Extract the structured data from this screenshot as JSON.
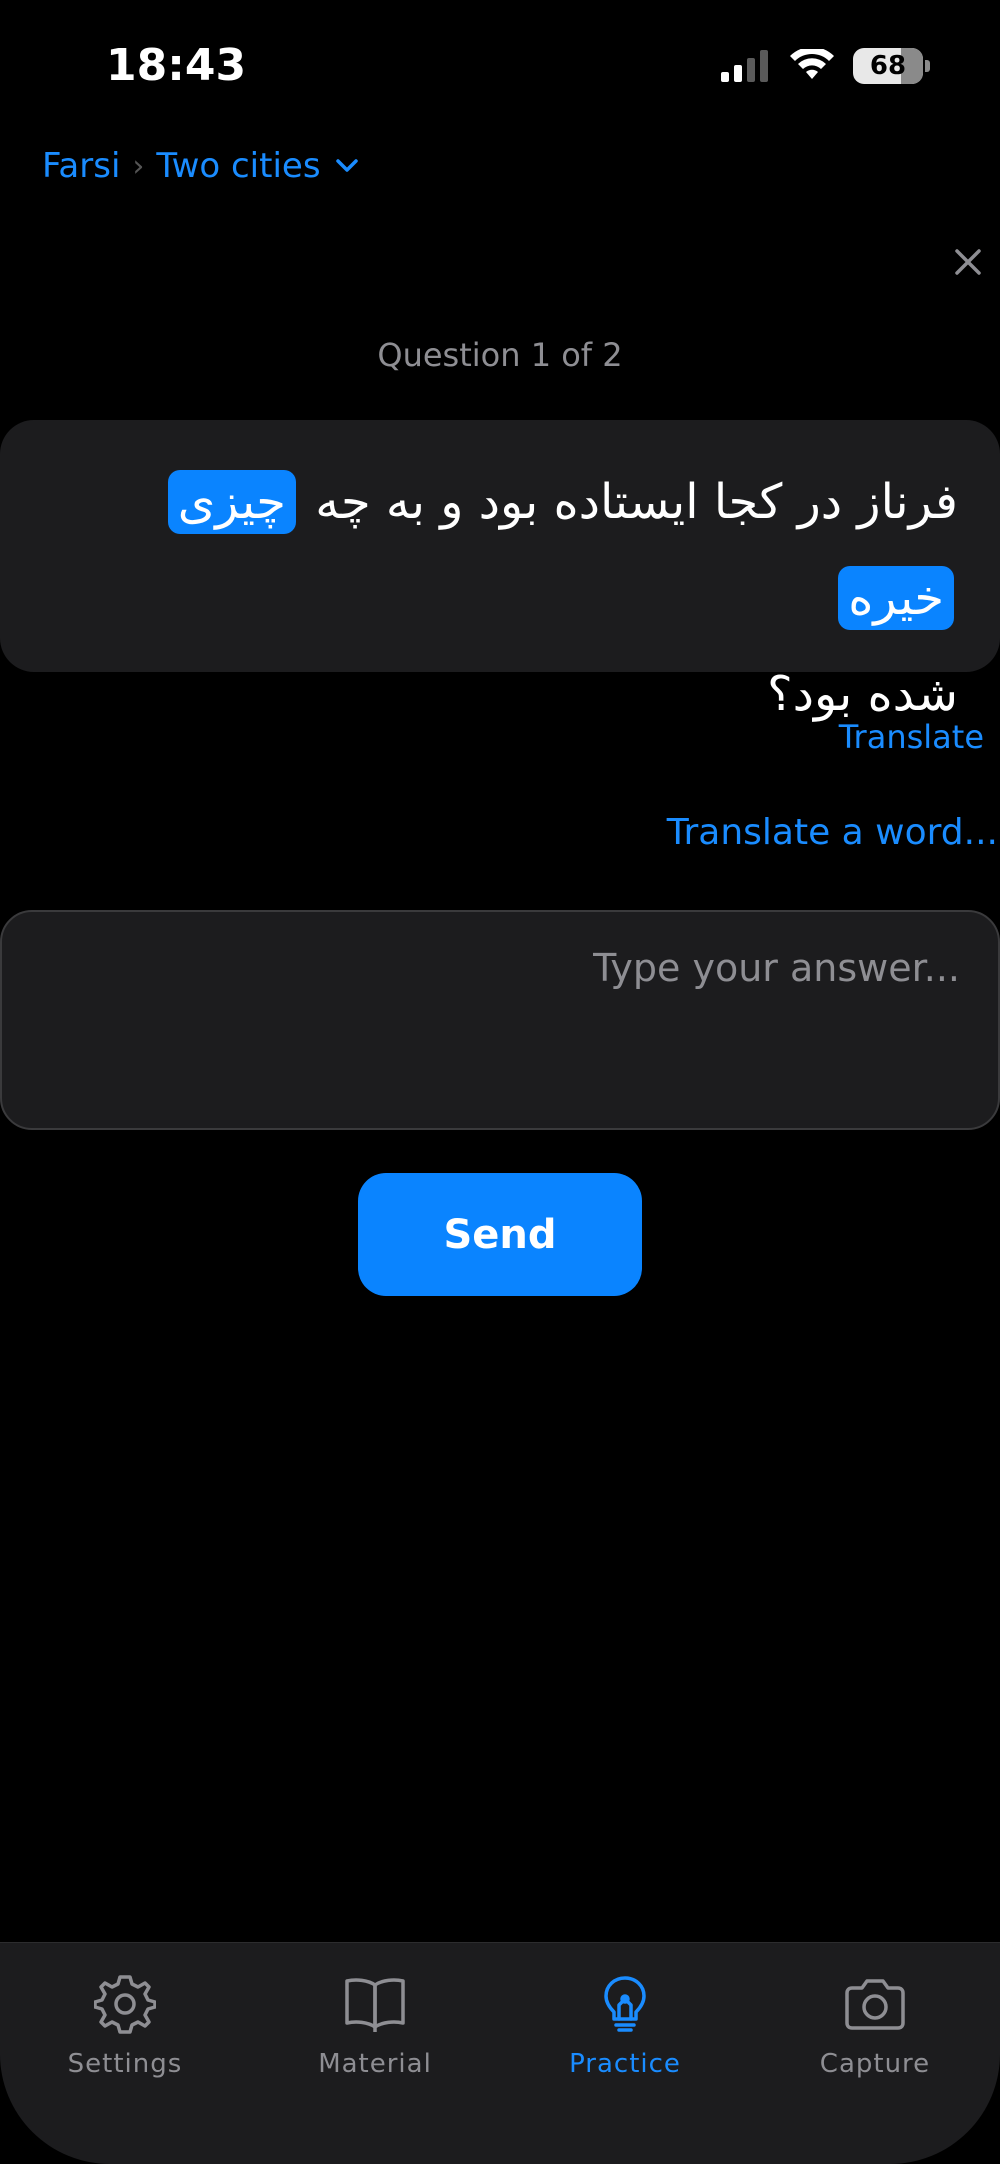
{
  "status_bar": {
    "time": "18:43",
    "battery": "68"
  },
  "breadcrumb": {
    "language": "Farsi",
    "separator": "›",
    "lesson": "Two cities"
  },
  "question": {
    "counter": "Question 1 of 2",
    "text_part1": "فرناز در کجا ایستاده بود و به چه",
    "highlight1": "چیزی",
    "highlight2": "خیره",
    "text_line2": "شده بود؟"
  },
  "links": {
    "translate": "Translate",
    "translate_word": "Translate a word..."
  },
  "answer": {
    "placeholder": "Type your answer...",
    "value": ""
  },
  "send_label": "Send",
  "tabs": [
    {
      "label": "Settings",
      "icon": "gear-icon",
      "active": false
    },
    {
      "label": "Material",
      "icon": "book-icon",
      "active": false
    },
    {
      "label": "Practice",
      "icon": "lightbulb-icon",
      "active": true
    },
    {
      "label": "Capture",
      "icon": "camera-icon",
      "active": false
    }
  ],
  "colors": {
    "accent": "#0a84ff",
    "card": "#1c1c1e",
    "background": "#000000",
    "muted": "#8e8e93"
  }
}
